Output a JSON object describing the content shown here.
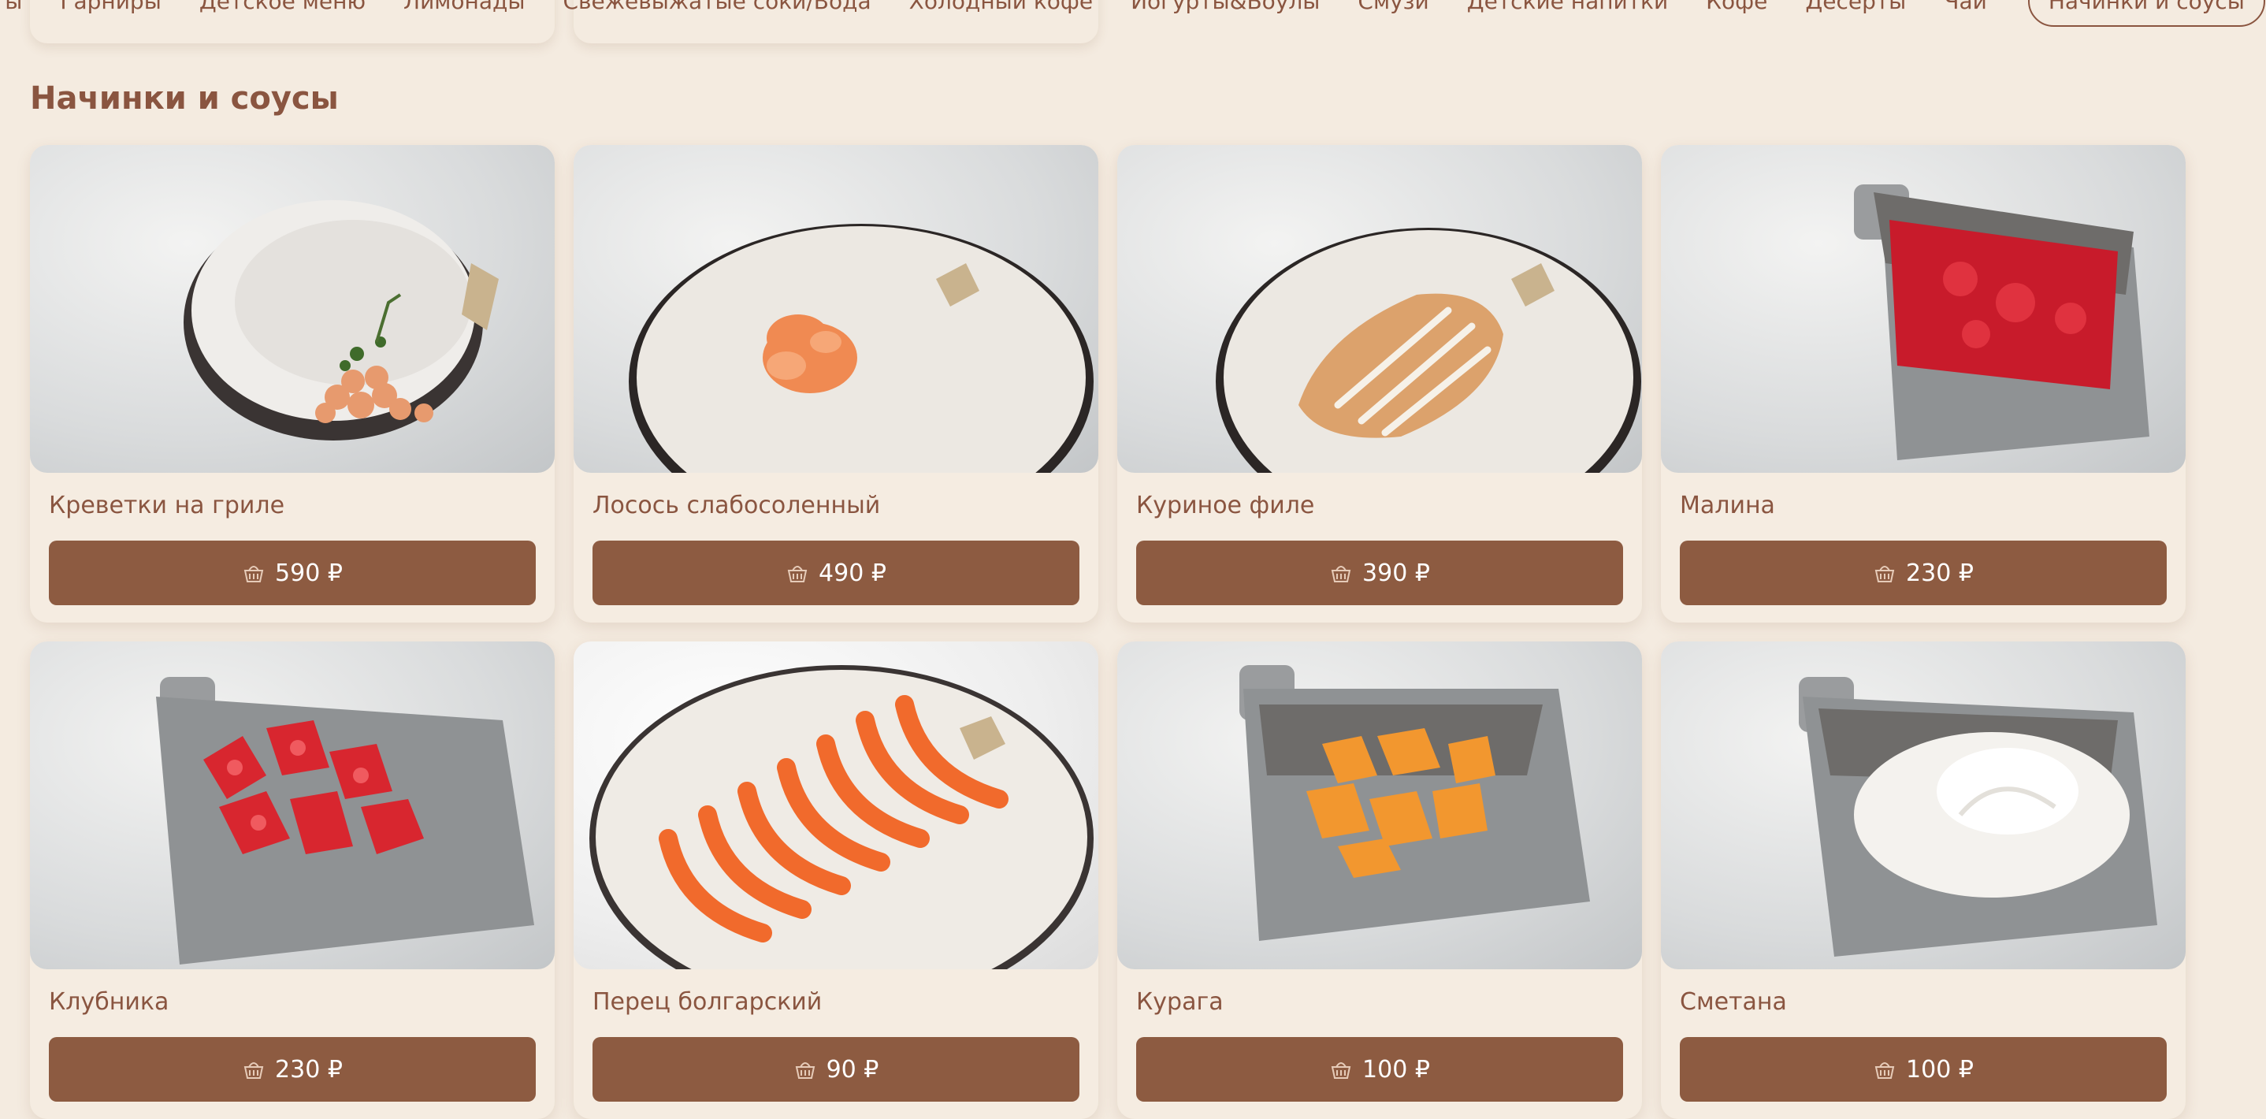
{
  "nav": {
    "items": [
      {
        "label": "ты",
        "active": false
      },
      {
        "label": "Гарниры",
        "active": false
      },
      {
        "label": "Детское меню",
        "active": false
      },
      {
        "label": "Лимонады",
        "active": false
      },
      {
        "label": "Свежевыжатые соки/Вода",
        "active": false
      },
      {
        "label": "Холодный кофе",
        "active": false
      },
      {
        "label": "Йогурты&Боулы",
        "active": false
      },
      {
        "label": "Смузи",
        "active": false
      },
      {
        "label": "Детские напитки",
        "active": false
      },
      {
        "label": "Кофе",
        "active": false
      },
      {
        "label": "Десерты",
        "active": false
      },
      {
        "label": "Чай",
        "active": false
      },
      {
        "label": "Начинки и соусы",
        "active": true
      }
    ]
  },
  "section": {
    "title": "Начинки и соусы"
  },
  "products": [
    {
      "name": "Креветки на гриле",
      "price": "590 ₽",
      "icon": "basket-icon"
    },
    {
      "name": "Лосось слабосоленный",
      "price": "490 ₽",
      "icon": "basket-icon"
    },
    {
      "name": "Куриное филе",
      "price": "390 ₽",
      "icon": "basket-icon"
    },
    {
      "name": "Малина",
      "price": "230 ₽",
      "icon": "basket-icon"
    },
    {
      "name": "Клубника",
      "price": "230 ₽",
      "icon": "basket-icon"
    },
    {
      "name": "Перец болгарский",
      "price": "90 ₽",
      "icon": "basket-icon"
    },
    {
      "name": "Курага",
      "price": "100 ₽",
      "icon": "basket-icon"
    },
    {
      "name": "Сметана",
      "price": "100 ₽",
      "icon": "basket-icon"
    }
  ],
  "colors": {
    "background": "#f4ebe0",
    "accent": "#8d5b41",
    "text": "#8a5540"
  }
}
